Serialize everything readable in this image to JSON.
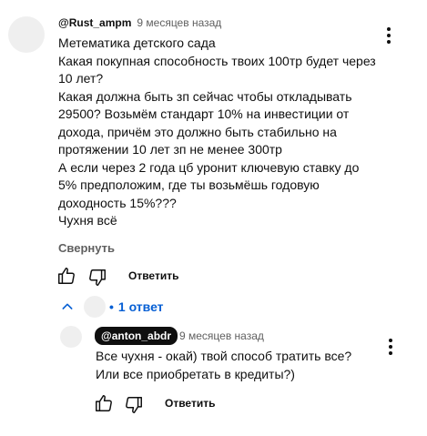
{
  "comment": {
    "author": "@Rust_ampm",
    "time": "9 месяцев назад",
    "text": "Метематика детского сада\nКакая покупная способность твоих 100тр будет через 10 лет?\nКакая должна быть зп сейчас чтобы откладывать 29500? Возьмём стандарт 10% на инвестиции от дохода, причём это должно быть стабильно на протяжении 10 лет зп не менее 300тр\nА если через 2 года цб уронит ключевую ставку до 5% предположим, где ты возьмёшь годовую доходность 15%???\nЧухня всё",
    "collapse_label": "Свернуть",
    "reply_label": "Ответить"
  },
  "replies_toggle": {
    "dot": "•",
    "label": "1 ответ"
  },
  "reply": {
    "author": "@anton_abdr",
    "time": "9 месяцев назад",
    "text": "Все чухня - окай) твой способ тратить все? Или все приобретать в кредиты?)",
    "reply_label": "Ответить"
  },
  "icons": {
    "like": "thumb-up-icon",
    "dislike": "thumb-down-icon",
    "more": "more-vertical-icon",
    "chevron": "chevron-up-icon"
  }
}
